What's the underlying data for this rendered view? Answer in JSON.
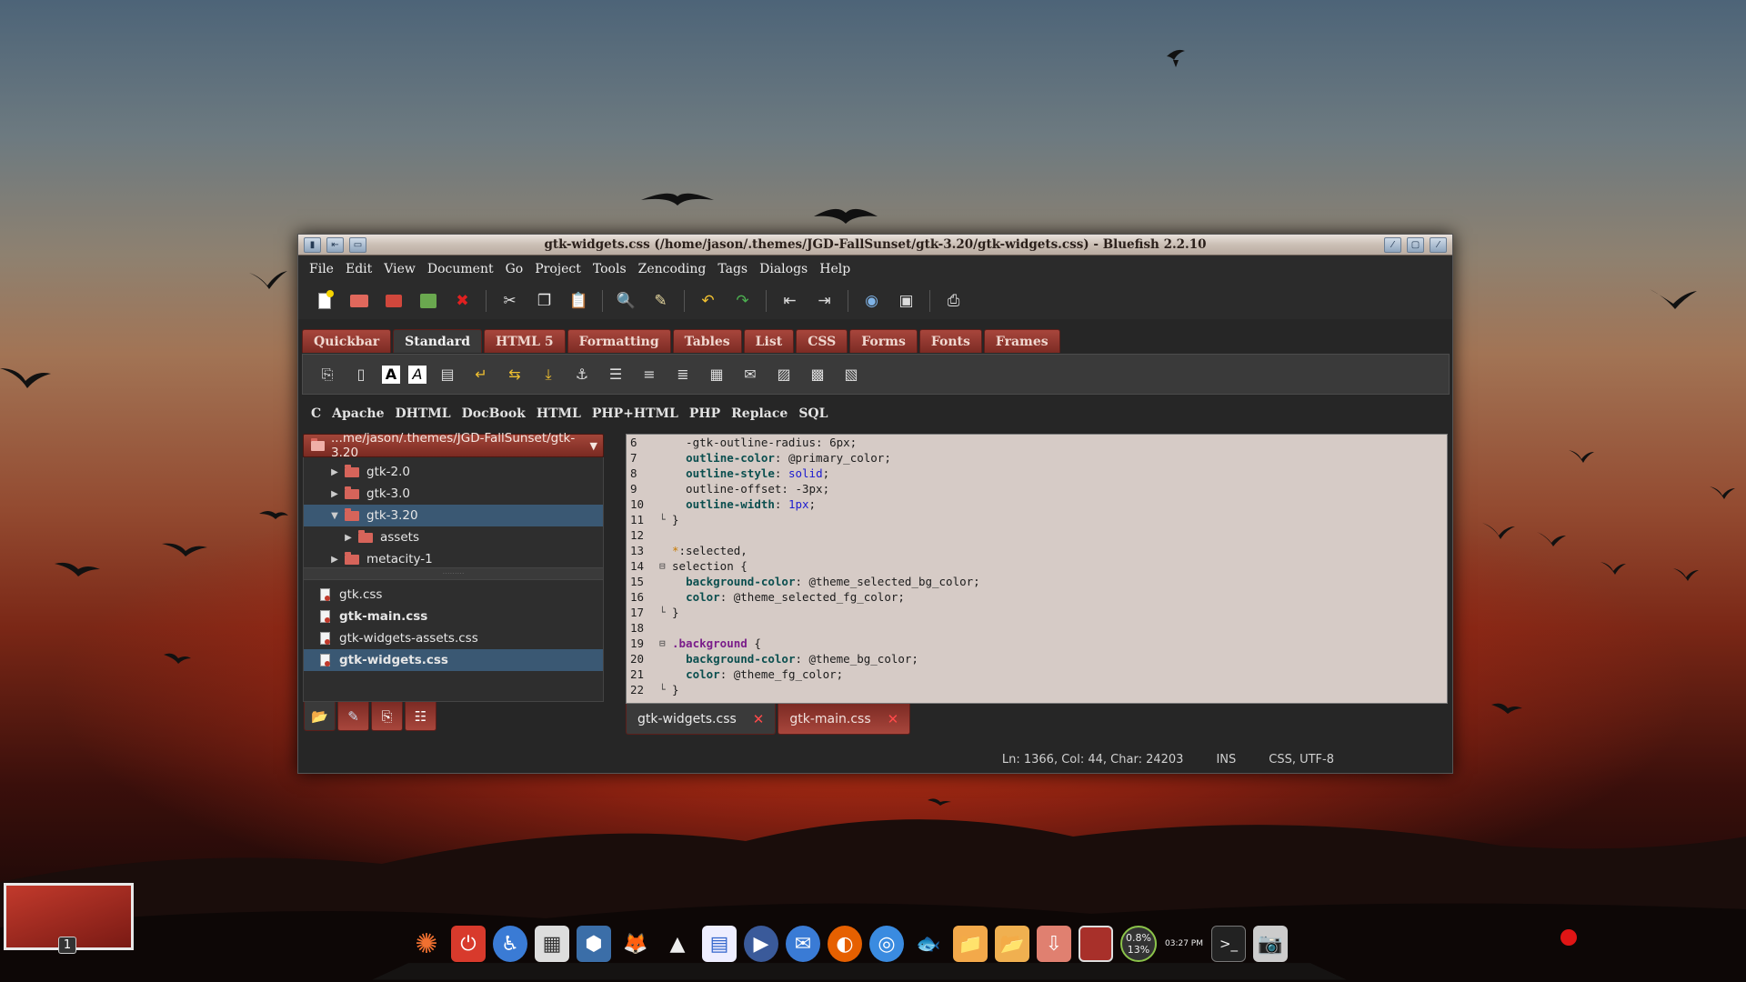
{
  "window": {
    "title": "gtk-widgets.css (/home/jason/.themes/JGD-FallSunset/gtk-3.20/gtk-widgets.css) - Bluefish 2.2.10"
  },
  "menubar": [
    "File",
    "Edit",
    "View",
    "Document",
    "Go",
    "Project",
    "Tools",
    "Zencoding",
    "Tags",
    "Dialogs",
    "Help"
  ],
  "main_tabs": [
    "Quickbar",
    "Standard",
    "HTML 5",
    "Formatting",
    "Tables",
    "List",
    "CSS",
    "Forms",
    "Fonts",
    "Frames"
  ],
  "main_tabs_active": "Standard",
  "sub_tabs": [
    "C",
    "Apache",
    "DHTML",
    "DocBook",
    "HTML",
    "PHP+HTML",
    "PHP",
    "Replace",
    "SQL"
  ],
  "file_panel": {
    "path": "...me/jason/.themes/JGD-FallSunset/gtk-3.20",
    "tree": [
      {
        "label": "gtk-2.0",
        "expander": "▶",
        "indent": 1,
        "selected": false
      },
      {
        "label": "gtk-3.0",
        "expander": "▶",
        "indent": 1,
        "selected": false
      },
      {
        "label": "gtk-3.20",
        "expander": "▼",
        "indent": 1,
        "selected": true
      },
      {
        "label": "assets",
        "expander": "▶",
        "indent": 2,
        "selected": false
      },
      {
        "label": "metacity-1",
        "expander": "▶",
        "indent": 1,
        "selected": false
      }
    ],
    "files": [
      {
        "label": "gtk.css",
        "bold": false,
        "selected": false
      },
      {
        "label": "gtk-main.css",
        "bold": true,
        "selected": false
      },
      {
        "label": "gtk-widgets-assets.css",
        "bold": false,
        "selected": false
      },
      {
        "label": "gtk-widgets.css",
        "bold": true,
        "selected": true
      }
    ]
  },
  "editor": {
    "lines": [
      {
        "n": "6",
        "fold": "",
        "parts": [
          [
            "code",
            "  -gtk-outline-radius: 6px;"
          ]
        ]
      },
      {
        "n": "7",
        "fold": "",
        "parts": [
          [
            "code",
            "  "
          ],
          [
            "prop",
            "outline-color"
          ],
          [
            "code",
            ": @primary_color;"
          ]
        ]
      },
      {
        "n": "8",
        "fold": "",
        "parts": [
          [
            "code",
            "  "
          ],
          [
            "prop",
            "outline-style"
          ],
          [
            "code",
            ": "
          ],
          [
            "val",
            "solid"
          ],
          [
            "code",
            ";"
          ]
        ]
      },
      {
        "n": "9",
        "fold": "",
        "parts": [
          [
            "code",
            "  outline-offset: -3px;"
          ]
        ]
      },
      {
        "n": "10",
        "fold": "",
        "parts": [
          [
            "code",
            "  "
          ],
          [
            "prop",
            "outline-width"
          ],
          [
            "code",
            ": "
          ],
          [
            "val",
            "1px"
          ],
          [
            "code",
            ";"
          ]
        ]
      },
      {
        "n": "11",
        "fold": "└",
        "parts": [
          [
            "code",
            "}"
          ]
        ]
      },
      {
        "n": "12",
        "fold": "",
        "parts": [
          [
            "code",
            ""
          ]
        ]
      },
      {
        "n": "13",
        "fold": "",
        "parts": [
          [
            "star",
            "*"
          ],
          [
            "code",
            ":selected,"
          ]
        ]
      },
      {
        "n": "14",
        "fold": "⊟",
        "parts": [
          [
            "code",
            "selection {"
          ]
        ]
      },
      {
        "n": "15",
        "fold": "",
        "parts": [
          [
            "code",
            "  "
          ],
          [
            "prop",
            "background-color"
          ],
          [
            "code",
            ": @theme_selected_bg_color;"
          ]
        ]
      },
      {
        "n": "16",
        "fold": "",
        "parts": [
          [
            "code",
            "  "
          ],
          [
            "prop",
            "color"
          ],
          [
            "code",
            ": @theme_selected_fg_color;"
          ]
        ]
      },
      {
        "n": "17",
        "fold": "└",
        "parts": [
          [
            "code",
            "}"
          ]
        ]
      },
      {
        "n": "18",
        "fold": "",
        "parts": [
          [
            "code",
            ""
          ]
        ]
      },
      {
        "n": "19",
        "fold": "⊟",
        "parts": [
          [
            "sel-c",
            ".background"
          ],
          [
            "code",
            " {"
          ]
        ]
      },
      {
        "n": "20",
        "fold": "",
        "parts": [
          [
            "code",
            "  "
          ],
          [
            "prop",
            "background-color"
          ],
          [
            "code",
            ": @theme_bg_color;"
          ]
        ]
      },
      {
        "n": "21",
        "fold": "",
        "parts": [
          [
            "code",
            "  "
          ],
          [
            "prop",
            "color"
          ],
          [
            "code",
            ": @theme_fg_color;"
          ]
        ]
      },
      {
        "n": "22",
        "fold": "└",
        "parts": [
          [
            "code",
            "}"
          ]
        ]
      }
    ]
  },
  "editor_tabs": [
    {
      "label": "gtk-widgets.css",
      "close": "✕",
      "active": true
    },
    {
      "label": "gtk-main.css",
      "close": "✕",
      "active": false
    }
  ],
  "status": {
    "position": "Ln: 1366, Col: 44, Char: 24203",
    "mode": "INS",
    "encoding": "CSS, UTF-8"
  },
  "workspace": {
    "number": "1"
  },
  "tray": {
    "cpu_top": "0.8%",
    "cpu_bottom": "13%",
    "clock": "03:27 PM"
  },
  "colors": {
    "accent_tab": "#a8463c",
    "selection": "#3a5873",
    "editor_bg": "#d6cbc6"
  },
  "toolbar_icons": [
    "new-file-icon",
    "open-icon",
    "save-icon",
    "save-as-icon",
    "close-icon",
    "cut-icon",
    "copy-icon",
    "paste-icon",
    "find-icon",
    "replace-icon",
    "undo-icon",
    "redo-icon",
    "unindent-icon",
    "indent-icon",
    "preview-icon",
    "fullscreen-icon",
    "print-icon"
  ]
}
